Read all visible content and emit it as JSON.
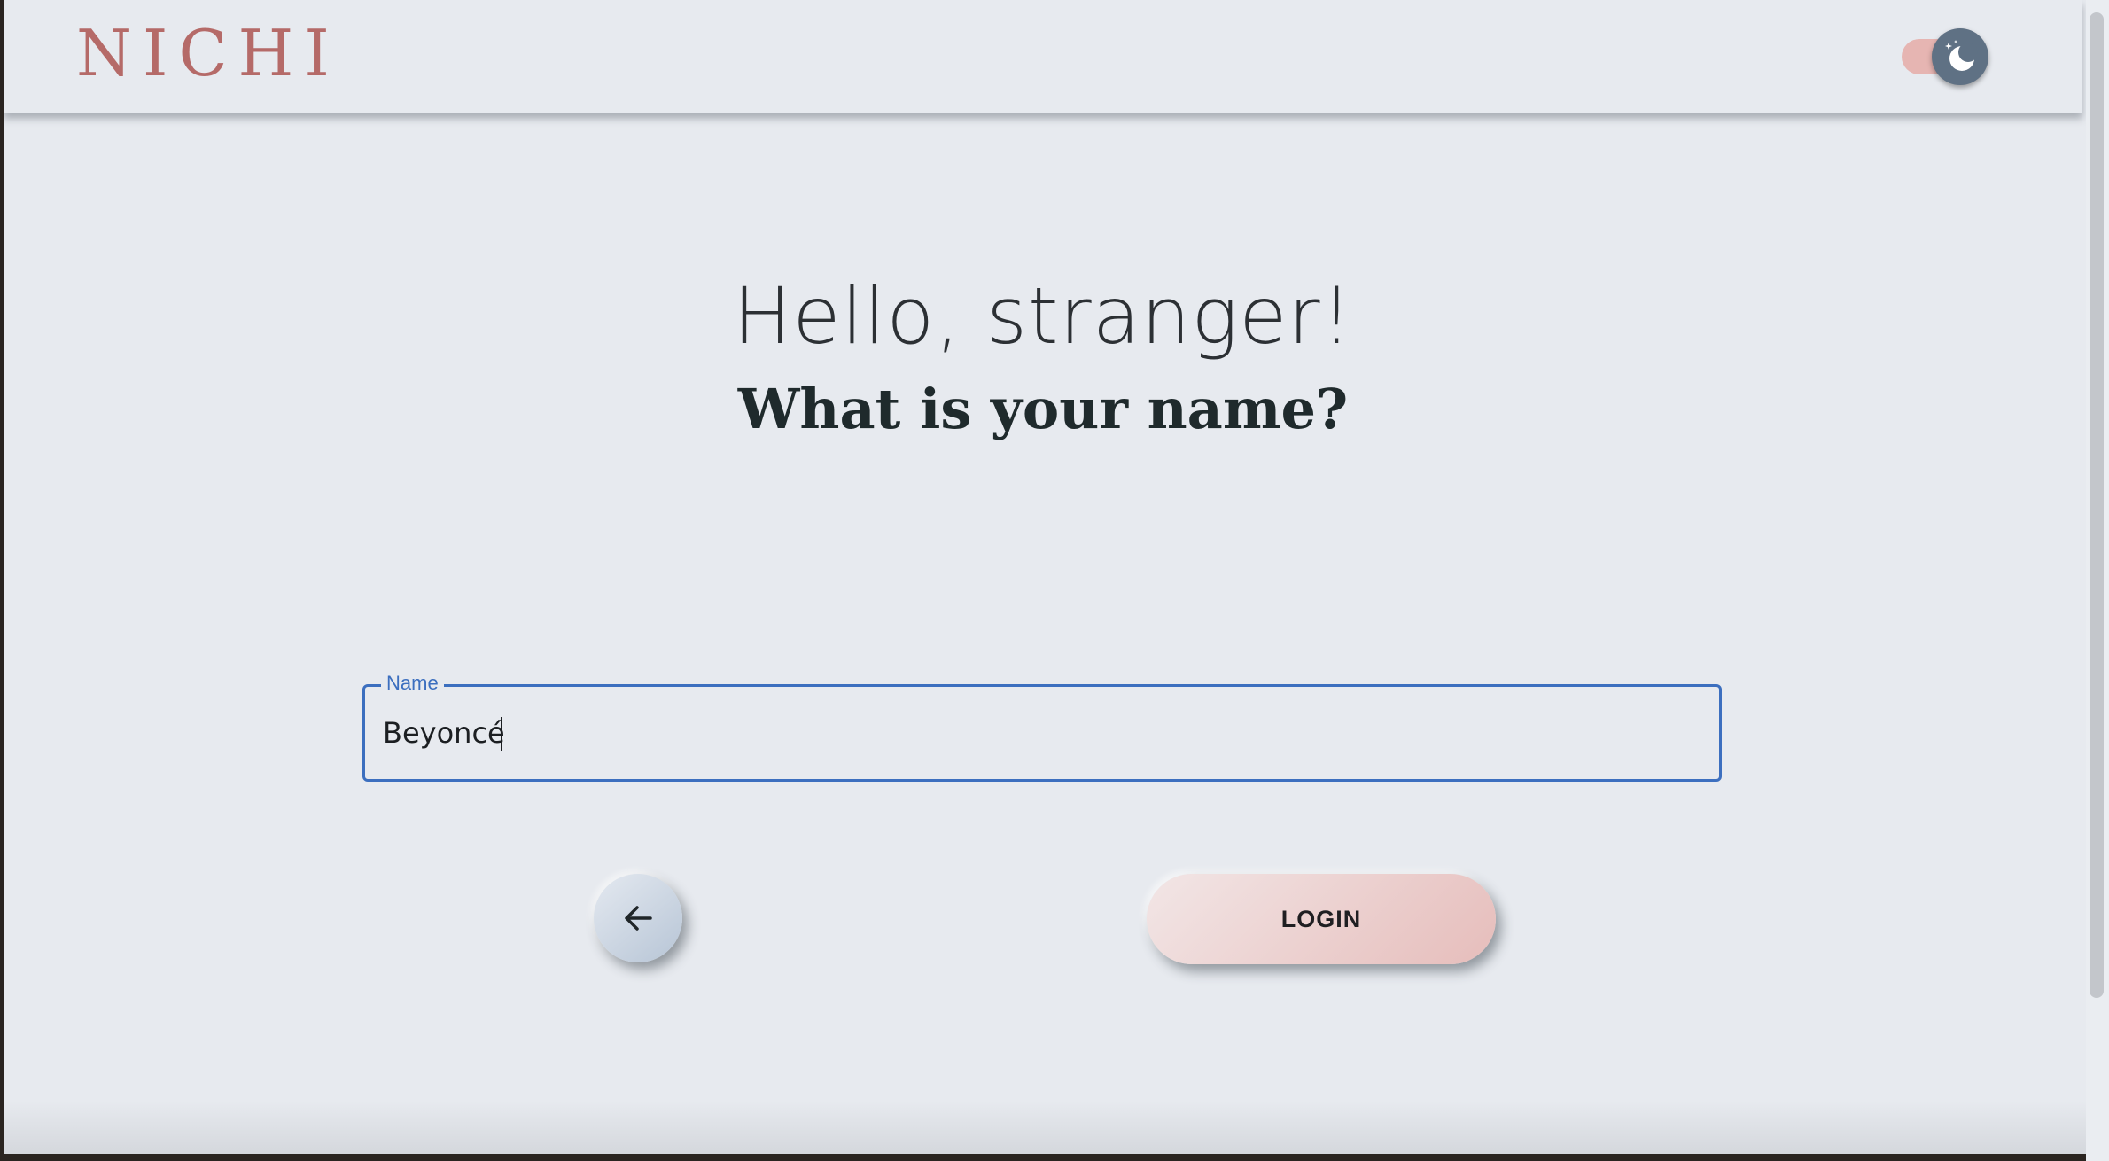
{
  "header": {
    "logo_text": "NICHI",
    "theme_toggle": {
      "state": "dark-mode",
      "icon": "moon-icon",
      "track_color": "#e6b5b2",
      "knob_color": "#5f7184"
    }
  },
  "main": {
    "greeting": "Hello, stranger!",
    "question": "What is your name?",
    "name_field": {
      "label": "Name",
      "value": "Beyoncé"
    },
    "back_button": {
      "icon": "arrow-left-icon"
    },
    "login_button": {
      "label": "LOGIN"
    }
  },
  "colors": {
    "brand": "#b56a68",
    "background": "#e7eaef",
    "focus_accent": "#3c6fbf",
    "login_button": "#e6bdbb"
  }
}
